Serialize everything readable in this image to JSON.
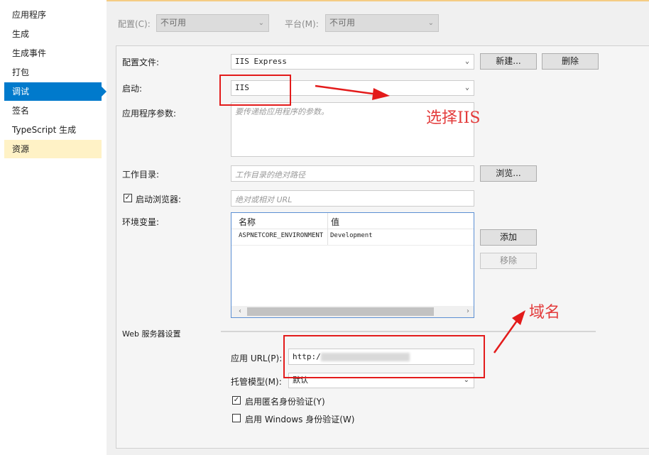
{
  "sidebar": {
    "items": [
      {
        "label": "应用程序"
      },
      {
        "label": "生成"
      },
      {
        "label": "生成事件"
      },
      {
        "label": "打包"
      },
      {
        "label": "调试"
      },
      {
        "label": "签名"
      },
      {
        "label": "TypeScript 生成"
      },
      {
        "label": "资源"
      }
    ],
    "active_index": 4
  },
  "config_bar": {
    "config_label": "配置(C):",
    "config_value": "不可用",
    "platform_label": "平台(M):",
    "platform_value": "不可用"
  },
  "debug": {
    "profile_label": "配置文件:",
    "profile_value": "IIS Express",
    "new_button": "新建...",
    "delete_button": "删除",
    "launch_label": "启动:",
    "launch_value": "IIS",
    "app_args_label": "应用程序参数:",
    "app_args_placeholder": "要传递给应用程序的参数。",
    "working_dir_label": "工作目录:",
    "working_dir_placeholder": "工作目录的绝对路径",
    "browse_button": "浏览...",
    "launch_browser_label": "启动浏览器:",
    "launch_browser_checked": true,
    "launch_browser_placeholder": "绝对或相对 URL",
    "env_label": "环境变量:",
    "env_columns": [
      "名称",
      "值"
    ],
    "env_rows": [
      {
        "name": "ASPNETCORE_ENVIRONMENT",
        "value": "Development"
      }
    ],
    "add_button": "添加",
    "remove_button": "移除",
    "web_server_heading": "Web 服务器设置",
    "app_url_label": "应用 URL(P):",
    "app_url_value": "http:/",
    "hosting_model_label": "托管模型(M):",
    "hosting_model_value": "默认",
    "anon_auth_label": "启用匿名身份验证(Y)",
    "anon_auth_checked": true,
    "windows_auth_label": "启用 Windows 身份验证(W)",
    "windows_auth_checked": false
  },
  "annotations": {
    "choose_iis": "选择IIS",
    "domain": "域名"
  },
  "colors": {
    "accent": "#007acc",
    "highlight": "#fff2c6",
    "annotation_red": "#e31b1b"
  }
}
